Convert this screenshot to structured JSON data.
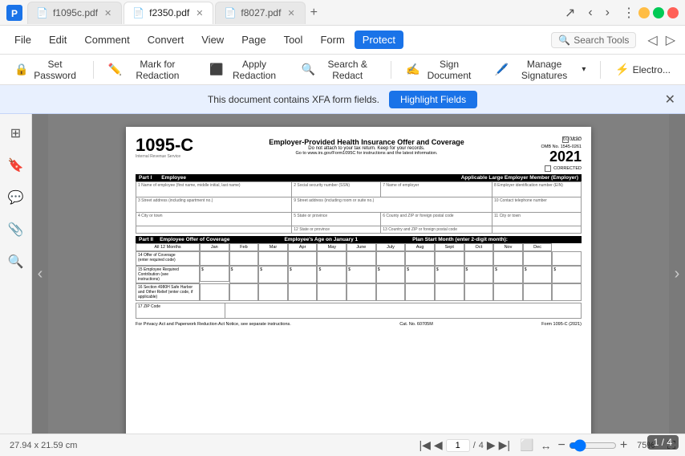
{
  "titleBar": {
    "tabs": [
      {
        "id": "tab1",
        "label": "f1095c.pdf",
        "active": false,
        "icon": "📄"
      },
      {
        "id": "tab2",
        "label": "f2350.pdf",
        "active": true,
        "icon": "📄"
      },
      {
        "id": "tab3",
        "label": "f8027.pdf",
        "active": false,
        "icon": "📄"
      }
    ],
    "addTabLabel": "+",
    "windowButtons": {
      "minimize": "—",
      "maximize": "⬜",
      "close": "✕"
    }
  },
  "menuBar": {
    "items": [
      {
        "id": "file",
        "label": "File",
        "active": false
      },
      {
        "id": "edit",
        "label": "Edit",
        "active": false
      },
      {
        "id": "comment",
        "label": "Comment",
        "active": false
      },
      {
        "id": "convert",
        "label": "Convert",
        "active": false
      },
      {
        "id": "view",
        "label": "View",
        "active": false
      },
      {
        "id": "page",
        "label": "Page",
        "active": false
      },
      {
        "id": "tool",
        "label": "Tool",
        "active": false
      },
      {
        "id": "form",
        "label": "Form",
        "active": false
      },
      {
        "id": "protect",
        "label": "Protect",
        "active": true
      }
    ],
    "searchPlaceholder": "Search Tools"
  },
  "toolbar": {
    "buttons": [
      {
        "id": "set-password",
        "label": "Set Password",
        "icon": "🔒"
      },
      {
        "id": "mark-redaction",
        "label": "Mark for Redaction",
        "icon": "✏️"
      },
      {
        "id": "apply-redaction",
        "label": "Apply Redaction",
        "icon": "⬛"
      },
      {
        "id": "search-redact",
        "label": "Search & Redact",
        "icon": "🔍"
      },
      {
        "id": "sign-doc",
        "label": "Sign Document",
        "icon": "✍️"
      },
      {
        "id": "manage-sigs",
        "label": "Manage Signatures",
        "icon": "🖊️"
      },
      {
        "id": "electro",
        "label": "Electro...",
        "icon": "⚡"
      }
    ]
  },
  "notification": {
    "message": "This document contains XFA form fields.",
    "highlightButton": "Highlight Fields",
    "closeLabel": "✕"
  },
  "sidebar": {
    "icons": [
      {
        "id": "pages",
        "icon": "⊞",
        "active": false
      },
      {
        "id": "bookmarks",
        "icon": "🔖",
        "active": false
      },
      {
        "id": "comments",
        "icon": "💬",
        "active": false
      },
      {
        "id": "attachments",
        "icon": "📎",
        "active": false
      },
      {
        "id": "search",
        "icon": "🔍",
        "active": false
      }
    ]
  },
  "pdfContent": {
    "pageNumber": "600120",
    "formNumber": "1095-C",
    "formTitle": "Employer-Provided Health Insurance Offer and Coverage",
    "formSubtitle": "Do not attach to your tax return. Keep for your records.",
    "formLink": "Go to www.irs.gov/Form1095C for instructions and the latest information.",
    "ombNumber": "OMB No. 1545-0261",
    "year": "2021",
    "voidLabel": "VOID",
    "correctedLabel": "CORRECTED",
    "irsLabel": "Internal Revenue Service",
    "partI": "Part I",
    "employeeLabel": "Employee",
    "aplLabel": "Applicable Large Employer Member (Employer)",
    "partII": "Part II",
    "employeeOfferLabel": "Employee Offer of Coverage",
    "ageLabel": "Employee's Age on January 1",
    "planStartLabel": "Plan Start Month (enter 2-digit month):",
    "months": [
      "All 12 Months",
      "Jan",
      "Feb",
      "Mar",
      "Apr",
      "May",
      "June",
      "July",
      "Aug",
      "Sept",
      "Oct",
      "Nov",
      "Dec"
    ],
    "fieldLabels": [
      "1 Name of employee (first name, middle initial, last name)",
      "2 Social security number (SSN)",
      "7 Name of employer",
      "8 Employer identification number (EIN)",
      "3 Street address (including apartment no.)",
      "9 Street address (including room or suite no.)",
      "10 Contact telephone number",
      "4 City or town",
      "5 State or province",
      "6 County and ZIP or foreign postal code",
      "11 City or town",
      "12 State or province",
      "13 Country and ZIP or foreign postal code",
      "14 Offer of Coverage (enter required code)",
      "15 Employee Required Contribution (see instructions)",
      "16 Section 4980H Safe Harbor and Other Relief (enter code, if applicable)",
      "17 ZIP Code",
      "For Privacy Act and Paperwork Reduction Act Notice, see separate instructions.",
      "Cat. No. 60705M",
      "Form 1095-C (2021)"
    ]
  },
  "statusBar": {
    "dimensions": "27.94 x 21.59 cm",
    "currentPage": "1",
    "totalPages": "4",
    "zoomLevel": "75%",
    "pageDisplay": "1 / 4"
  }
}
